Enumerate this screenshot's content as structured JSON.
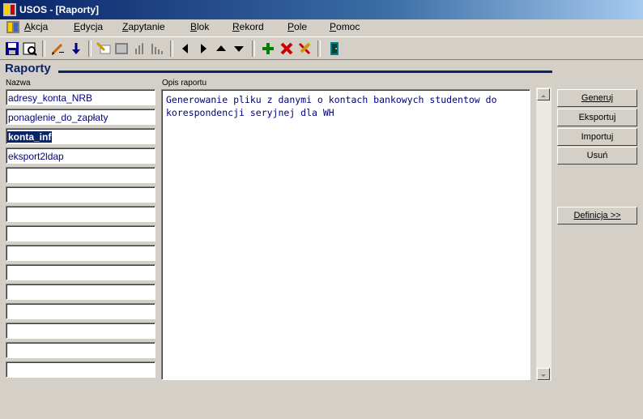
{
  "window": {
    "title": "USOS - [Raporty]"
  },
  "menu": {
    "items": [
      {
        "label": "Akcja",
        "u": "A",
        "rest": "kcja"
      },
      {
        "label": "Edycja",
        "u": "E",
        "rest": "dycja"
      },
      {
        "label": "Zapytanie",
        "u": "Z",
        "rest": "apytanie"
      },
      {
        "label": "Blok",
        "u": "B",
        "rest": "lok"
      },
      {
        "label": "Rekord",
        "u": "R",
        "rest": "ekord"
      },
      {
        "label": "Pole",
        "u": "P",
        "rest": "ole"
      },
      {
        "label": "Pomoc",
        "u": "P",
        "rest": "omoc"
      }
    ]
  },
  "toolbar": {
    "icons": [
      "save-icon",
      "print-preview-icon",
      "edit-pencil-icon",
      "download-arrow-icon",
      "query-enter-icon",
      "query-execute-icon",
      "bar-chart-icon",
      "bar-chart-2-icon",
      "prev-block-icon",
      "next-block-icon",
      "prev-record-icon",
      "next-record-icon",
      "insert-record-icon",
      "delete-record-icon",
      "clear-record-icon",
      "exit-door-icon"
    ]
  },
  "section": {
    "title": "Raporty"
  },
  "labels": {
    "name": "Nazwa",
    "description": "Opis raportu"
  },
  "reports": {
    "names": [
      "adresy_konta_NRB",
      "ponaglenie_do_zapłaty",
      "konta_inf",
      "eksport2ldap",
      "",
      "",
      "",
      "",
      "",
      "",
      "",
      "",
      "",
      "",
      ""
    ],
    "selected_index": 2
  },
  "description": {
    "text": "Generowanie pliku z danymi o kontach bankowych studentow do korespondencji seryjnej dla WH"
  },
  "buttons": {
    "generate": "Generuj",
    "export": "Eksportuj",
    "import": "Importuj",
    "delete": "Usuń",
    "definition": "Definicja >>"
  },
  "colors": {
    "title_bar": "#0a246a",
    "field_text": "#000080",
    "header_text": "#0a246a"
  }
}
